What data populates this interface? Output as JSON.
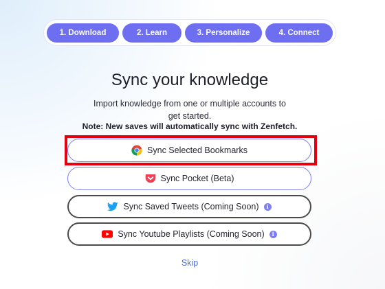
{
  "stepper": {
    "steps": [
      {
        "label": "1. Download"
      },
      {
        "label": "2. Learn"
      },
      {
        "label": "3. Personalize"
      },
      {
        "label": "4. Connect"
      }
    ]
  },
  "header": {
    "title": "Sync your knowledge",
    "subtitle": "Import knowledge from one or multiple accounts to get started.",
    "note": "Note: New saves will automatically sync with Zenfetch."
  },
  "sync_options": [
    {
      "label": "Sync Selected Bookmarks",
      "icon": "chrome-icon"
    },
    {
      "label": "Sync Pocket (Beta)",
      "icon": "pocket-icon"
    },
    {
      "label": "Sync Saved Tweets (Coming Soon)",
      "icon": "twitter-icon",
      "info_icon": "info-icon"
    },
    {
      "label": "Sync Youtube Playlists (Coming Soon)",
      "icon": "youtube-icon",
      "info_icon": "info-icon"
    }
  ],
  "skip_label": "Skip",
  "colors": {
    "accent": "#6d6ef0",
    "highlight": "#e4000f",
    "link": "#4a6fd6"
  }
}
